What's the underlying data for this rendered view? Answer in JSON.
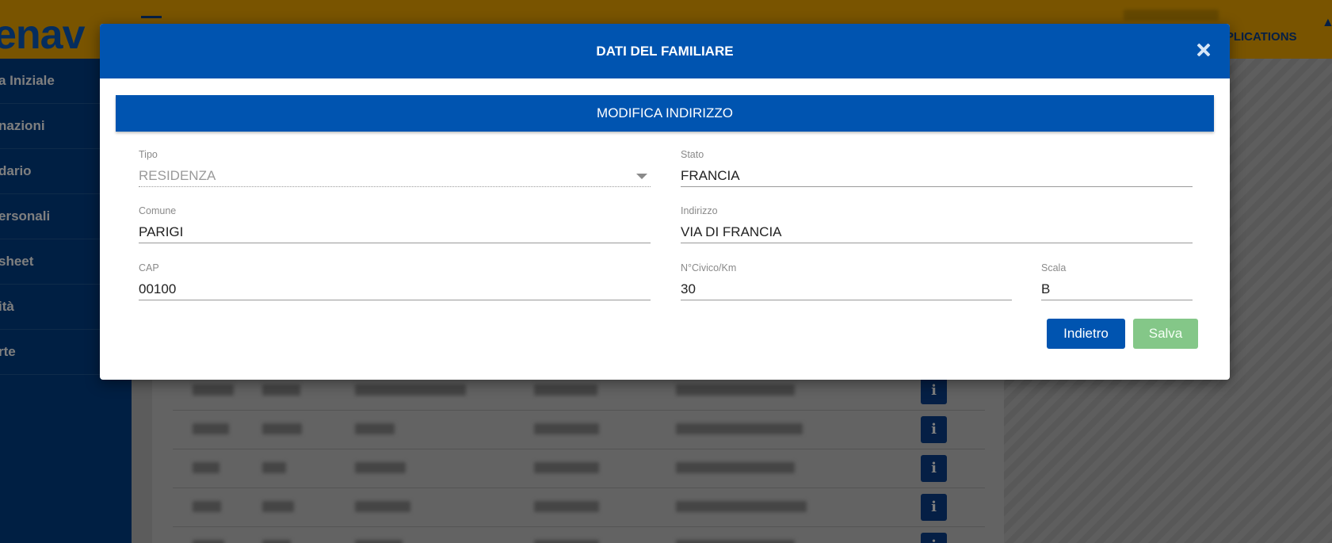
{
  "app": {
    "logo_text": "enav",
    "top_applications": "APPLICATIONS",
    "sidebar": {
      "items": [
        {
          "label": "a Iniziale",
          "has_children": false
        },
        {
          "label": "nazioni",
          "has_children": true
        },
        {
          "label": "dario",
          "has_children": false
        },
        {
          "label": "ersonali",
          "has_children": true
        },
        {
          "label": "sheet",
          "has_children": true
        },
        {
          "label": "ità",
          "has_children": false
        },
        {
          "label": "rte",
          "has_children": true
        }
      ]
    },
    "table": {
      "row_action_icon": "info-icon",
      "row_action_label": "i",
      "visible_rows": 5
    }
  },
  "modal": {
    "title": "DATI DEL FAMILIARE",
    "close_icon": "close-icon",
    "section_title": "MODIFICA INDIRIZZO",
    "fields": {
      "tipo": {
        "label": "Tipo",
        "value": "RESIDENZA",
        "disabled": true
      },
      "stato": {
        "label": "Stato",
        "value": "FRANCIA"
      },
      "comune": {
        "label": "Comune",
        "value": "PARIGI"
      },
      "indirizzo": {
        "label": "Indirizzo",
        "value": "VIA DI FRANCIA"
      },
      "cap": {
        "label": "CAP",
        "value": "00100"
      },
      "civico": {
        "label": "N°Civico/Km",
        "value": "30"
      },
      "scala": {
        "label": "Scala",
        "value": "B"
      }
    },
    "buttons": {
      "back_label": "Indietro",
      "save_label": "Salva"
    }
  },
  "colors": {
    "topbar": "#f2a900",
    "primary": "#0054b0",
    "sidebar": "#003f86",
    "save_disabled": "#84c788"
  }
}
